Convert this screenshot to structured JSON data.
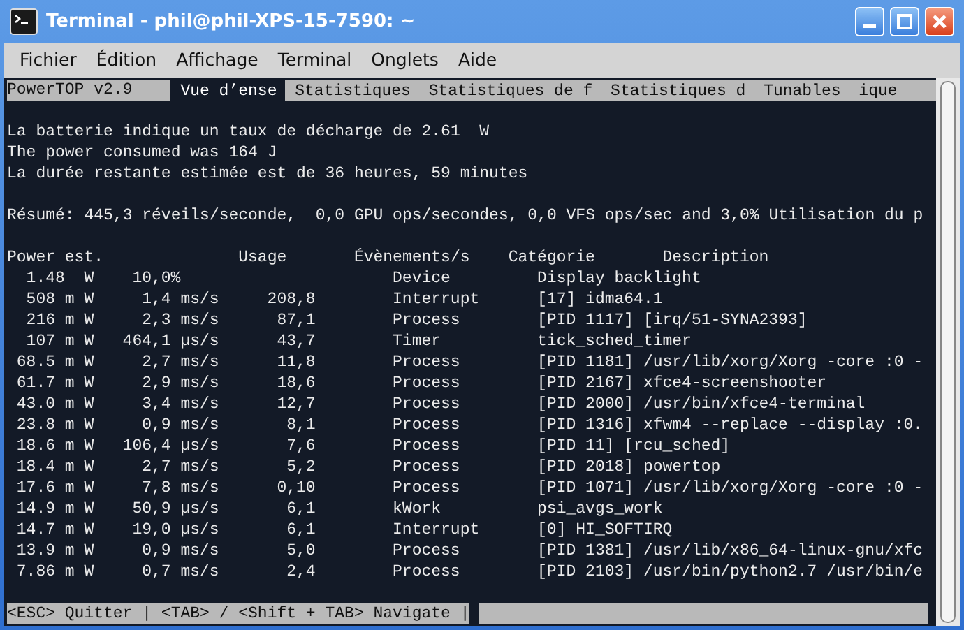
{
  "window": {
    "title": "Terminal - phil@phil-XPS-15-7590: ~"
  },
  "menu": [
    "Fichier",
    "Édition",
    "Affichage",
    "Terminal",
    "Onglets",
    "Aide"
  ],
  "app_title": "PowerTOP v2.9",
  "tabs": [
    {
      "label": "Vue d’ense",
      "selected": true
    },
    {
      "label": "Statistiques",
      "selected": false
    },
    {
      "label": "Statistiques de f",
      "selected": false
    },
    {
      "label": "Statistiques d",
      "selected": false
    },
    {
      "label": "Tunables",
      "selected": false
    },
    {
      "label": "ique",
      "selected": false
    }
  ],
  "summary_lines": [
    "La batterie indique un taux de décharge de 2.61  W",
    "The power consumed was 164 J",
    "La durée restante estimée est de 36 heures, 59 minutes"
  ],
  "resume": "Résumé: 445,3 réveils/seconde,  0,0 GPU ops/secondes, 0,0 VFS ops/sec and 3,0% Utilisation du p",
  "table": {
    "columns": [
      "Power est.",
      "Usage",
      "Évènements/s",
      "Catégorie",
      "Description"
    ],
    "rows": [
      {
        "kind": "device",
        "power": "1.48  W",
        "usage": "10,0%",
        "events": "",
        "category": "Device",
        "description": "Display backlight"
      },
      {
        "kind": "item",
        "power": "508 m W",
        "usage": "1,4 ms/s",
        "events": "208,8",
        "category": "Interrupt",
        "description": "[17] idma64.1"
      },
      {
        "kind": "item",
        "power": "216 m W",
        "usage": "2,3 ms/s",
        "events": "87,1",
        "category": "Process",
        "description": "[PID 1117] [irq/51-SYNA2393]"
      },
      {
        "kind": "item",
        "power": "107 m W",
        "usage": "464,1 µs/s",
        "events": "43,7",
        "category": "Timer",
        "description": "tick_sched_timer"
      },
      {
        "kind": "item",
        "power": "68.5 m W",
        "usage": "2,7 ms/s",
        "events": "11,8",
        "category": "Process",
        "description": "[PID 1181] /usr/lib/xorg/Xorg -core :0 -"
      },
      {
        "kind": "item",
        "power": "61.7 m W",
        "usage": "2,9 ms/s",
        "events": "18,6",
        "category": "Process",
        "description": "[PID 2167] xfce4-screenshooter"
      },
      {
        "kind": "item",
        "power": "43.0 m W",
        "usage": "3,4 ms/s",
        "events": "12,7",
        "category": "Process",
        "description": "[PID 2000] /usr/bin/xfce4-terminal"
      },
      {
        "kind": "item",
        "power": "23.8 m W",
        "usage": "0,9 ms/s",
        "events": "8,1",
        "category": "Process",
        "description": "[PID 1316] xfwm4 --replace --display :0."
      },
      {
        "kind": "item",
        "power": "18.6 m W",
        "usage": "106,4 µs/s",
        "events": "7,6",
        "category": "Process",
        "description": "[PID 11] [rcu_sched]"
      },
      {
        "kind": "item",
        "power": "18.4 m W",
        "usage": "2,7 ms/s",
        "events": "5,2",
        "category": "Process",
        "description": "[PID 2018] powertop"
      },
      {
        "kind": "item",
        "power": "17.6 m W",
        "usage": "7,8 ms/s",
        "events": "0,10",
        "category": "Process",
        "description": "[PID 1071] /usr/lib/xorg/Xorg -core :0 -"
      },
      {
        "kind": "item",
        "power": "14.9 m W",
        "usage": "50,9 µs/s",
        "events": "6,1",
        "category": "kWork",
        "description": "psi_avgs_work"
      },
      {
        "kind": "item",
        "power": "14.7 m W",
        "usage": "19,0 µs/s",
        "events": "6,1",
        "category": "Interrupt",
        "description": "[0] HI_SOFTIRQ"
      },
      {
        "kind": "item",
        "power": "13.9 m W",
        "usage": "0,9 ms/s",
        "events": "5,0",
        "category": "Process",
        "description": "[PID 1381] /usr/lib/x86_64-linux-gnu/xfc"
      },
      {
        "kind": "item",
        "power": "7.86 m W",
        "usage": "0,7 ms/s",
        "events": "2,4",
        "category": "Process",
        "description": "[PID 2103] /usr/bin/python2.7 /usr/bin/e"
      }
    ]
  },
  "status_bar": "<ESC> Quitter | <TAB> / <Shift + TAB> Navigate |"
}
